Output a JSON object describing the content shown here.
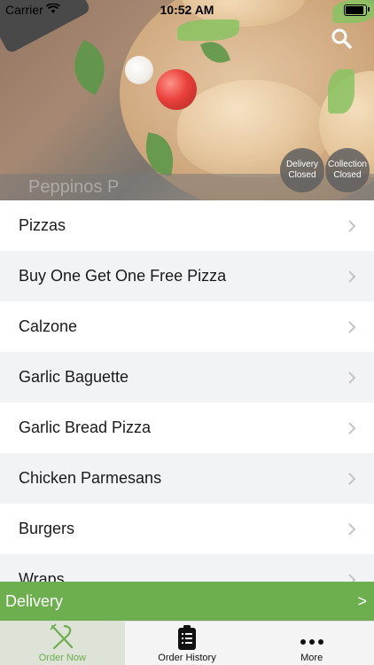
{
  "status_bar": {
    "carrier": "Carrier",
    "time": "10:52 AM"
  },
  "hero": {
    "restaurant_name": "Peppinos P",
    "delivery_badge": {
      "line1": "Delivery",
      "line2": "Closed"
    },
    "collection_badge": {
      "line1": "Collection",
      "line2": "Closed"
    }
  },
  "menu": {
    "categories": [
      "Pizzas",
      "Buy One Get One Free Pizza",
      "Calzone",
      "Garlic Baguette",
      "Garlic Bread Pizza",
      "Chicken Parmesans",
      "Burgers",
      "Wraps"
    ]
  },
  "delivery_bar": {
    "label": "Delivery",
    "chevron": ">"
  },
  "tabs": [
    {
      "label": "Order Now",
      "icon": "fork-knife-icon",
      "active": true
    },
    {
      "label": "Order History",
      "icon": "clipboard-list-icon",
      "active": false
    },
    {
      "label": "More",
      "icon": "more-dots-icon",
      "active": false
    }
  ],
  "colors": {
    "accent_green": "#6dae4f",
    "row_alt": "#f2f3f5",
    "badge_gray": "#5f5f5f"
  }
}
